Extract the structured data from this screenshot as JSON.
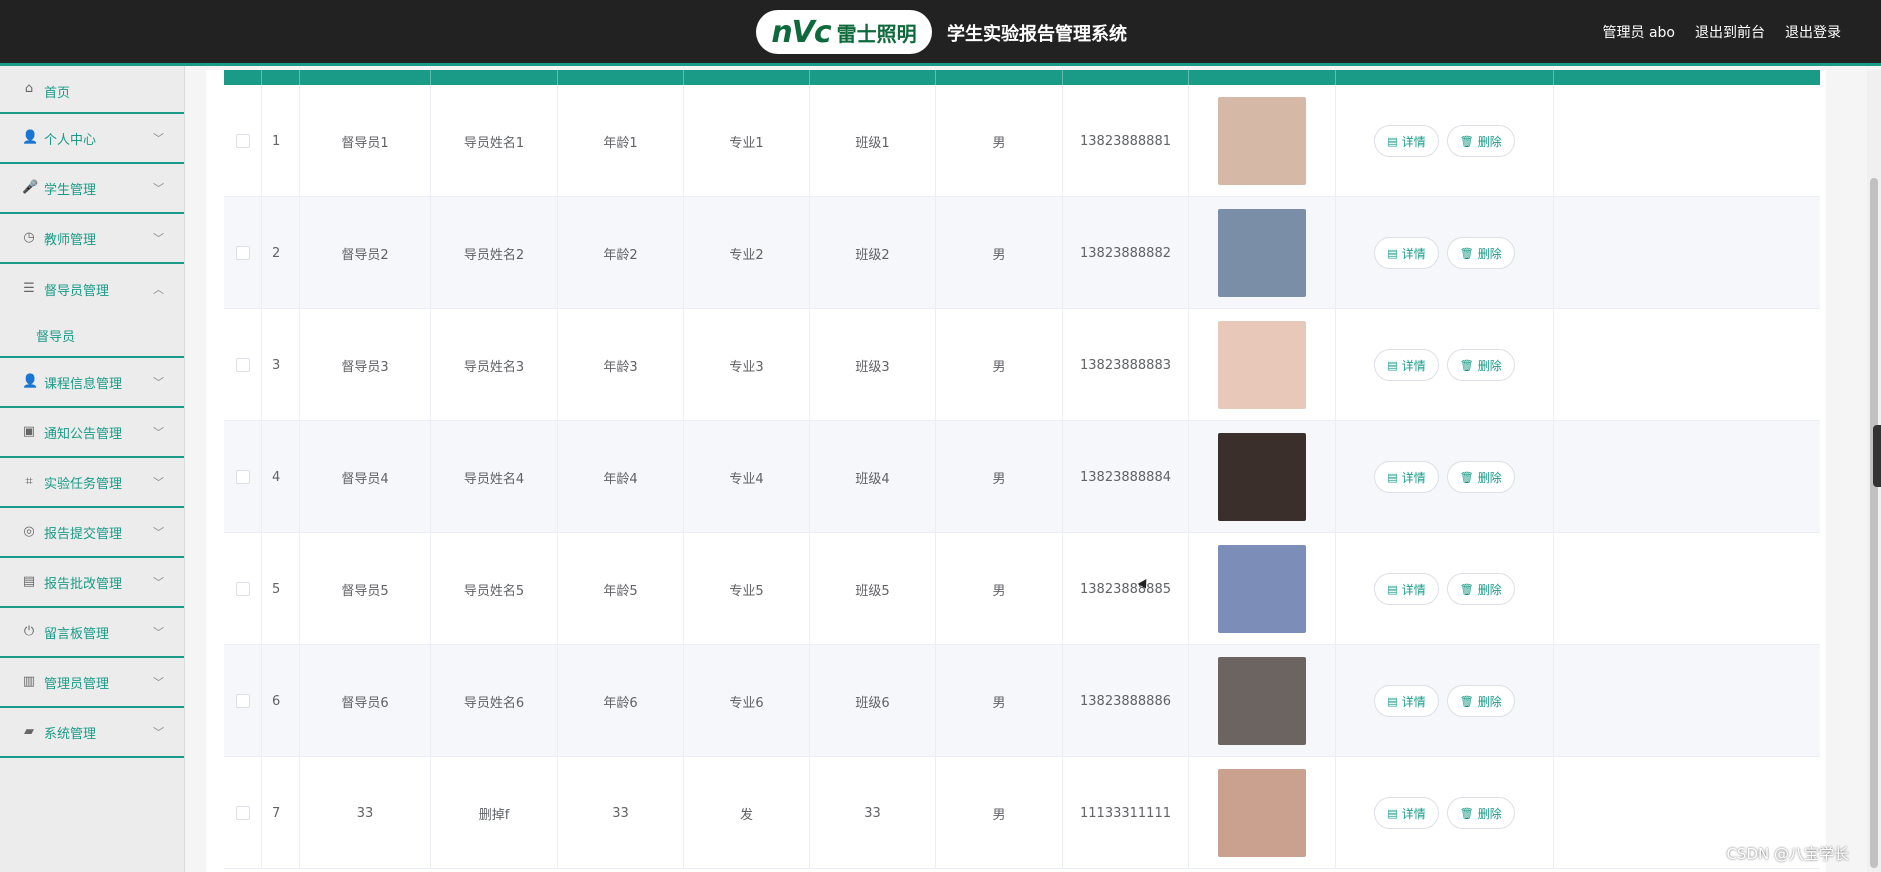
{
  "header": {
    "logo_brand": "nVc",
    "logo_cn": "雷士照明",
    "title": "学生实验报告管理系统",
    "user_label": "管理员 abo",
    "front_link": "退出到前台",
    "logout_link": "退出登录"
  },
  "sidebar": {
    "home": "首页",
    "items": [
      {
        "label": "个人中心",
        "icon": "user-icon"
      },
      {
        "label": "学生管理",
        "icon": "mic-icon"
      },
      {
        "label": "教师管理",
        "icon": "clock-icon"
      },
      {
        "label": "督导员管理",
        "icon": "sliders-icon",
        "open": true
      },
      {
        "label": "课程信息管理",
        "icon": "user-icon"
      },
      {
        "label": "通知公告管理",
        "icon": "image-icon"
      },
      {
        "label": "实验任务管理",
        "icon": "crop-icon"
      },
      {
        "label": "报告提交管理",
        "icon": "globe-icon"
      },
      {
        "label": "报告批改管理",
        "icon": "document-icon"
      },
      {
        "label": "留言板管理",
        "icon": "power-icon"
      },
      {
        "label": "管理员管理",
        "icon": "clipboard-icon"
      },
      {
        "label": "系统管理",
        "icon": "thumb-icon"
      }
    ],
    "submenu": "督导员"
  },
  "table": {
    "rows": [
      {
        "idx": "1",
        "account": "督导员1",
        "name": "导员姓名1",
        "age": "年龄1",
        "major": "专业1",
        "class": "班级1",
        "gender": "男",
        "phone": "13823888881",
        "avatar_color": "#d6b8a6"
      },
      {
        "idx": "2",
        "account": "督导员2",
        "name": "导员姓名2",
        "age": "年龄2",
        "major": "专业2",
        "class": "班级2",
        "gender": "男",
        "phone": "13823888882",
        "avatar_color": "#7a8ea8"
      },
      {
        "idx": "3",
        "account": "督导员3",
        "name": "导员姓名3",
        "age": "年龄3",
        "major": "专业3",
        "class": "班级3",
        "gender": "男",
        "phone": "13823888883",
        "avatar_color": "#e8c8b8"
      },
      {
        "idx": "4",
        "account": "督导员4",
        "name": "导员姓名4",
        "age": "年龄4",
        "major": "专业4",
        "class": "班级4",
        "gender": "男",
        "phone": "13823888884",
        "avatar_color": "#3a2f2a"
      },
      {
        "idx": "5",
        "account": "督导员5",
        "name": "导员姓名5",
        "age": "年龄5",
        "major": "专业5",
        "class": "班级5",
        "gender": "男",
        "phone": "13823888885",
        "avatar_color": "#7c8db8"
      },
      {
        "idx": "6",
        "account": "督导员6",
        "name": "导员姓名6",
        "age": "年龄6",
        "major": "专业6",
        "class": "班级6",
        "gender": "男",
        "phone": "13823888886",
        "avatar_color": "#6b6461"
      },
      {
        "idx": "7",
        "account": "33",
        "name": "删掉f",
        "age": "33",
        "major": "发",
        "class": "33",
        "gender": "男",
        "phone": "11133311111",
        "avatar_color": "#c9a18e"
      }
    ],
    "detail_label": "详情",
    "delete_label": "删除"
  },
  "watermark": "CSDN @八宝学长",
  "colors": {
    "accent": "#1a9b88",
    "header_bg": "#222222"
  }
}
